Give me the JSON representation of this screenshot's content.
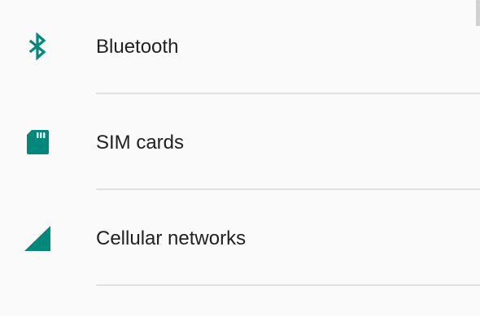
{
  "accent_color": "#00897b",
  "settings": {
    "items": [
      {
        "label": "Bluetooth",
        "icon": "bluetooth-icon"
      },
      {
        "label": "SIM cards",
        "icon": "sim-card-icon"
      },
      {
        "label": "Cellular networks",
        "icon": "cellular-signal-icon"
      }
    ]
  }
}
